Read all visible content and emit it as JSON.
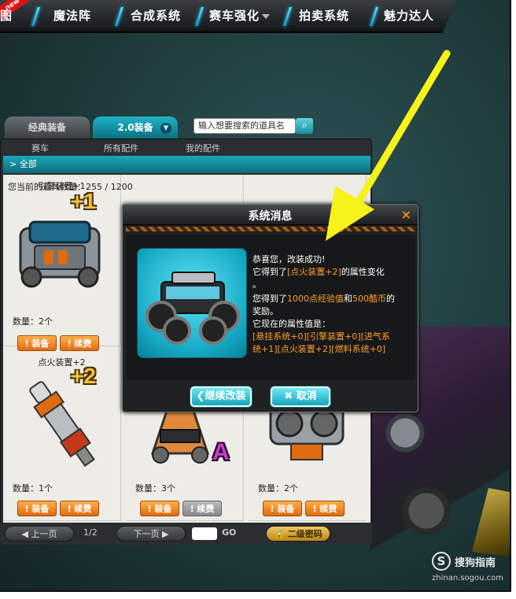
{
  "topnav": {
    "items": [
      {
        "label": "图"
      },
      {
        "label": "魔法阵"
      },
      {
        "label": "合成系统"
      },
      {
        "label": "赛车强化"
      },
      {
        "label": "拍卖系统"
      },
      {
        "label": "魅力达人"
      }
    ],
    "new_badge": "new"
  },
  "inventory": {
    "tabs": {
      "classic": "经典装备",
      "v20": "2.0装备"
    },
    "search_placeholder": "输入想要搜索的道具名",
    "subtabs": [
      "赛车",
      "所有配件",
      "我的配件"
    ],
    "category": "全部",
    "count_text": "您当前的道具数量：255 / 1200",
    "items": [
      {
        "name": "引擎装置+1",
        "badge": "+1",
        "qty": "数量：2个",
        "equip": "装备",
        "renew": "续费",
        "renew_disabled": false
      },
      {
        "name": "",
        "badge": "",
        "qty": "",
        "equip": "",
        "renew": "",
        "renew_disabled": false
      },
      {
        "name": "",
        "badge": "",
        "qty": "",
        "equip": "",
        "renew": "",
        "renew_disabled": false
      },
      {
        "name": "点火装置+2",
        "badge": "+2",
        "qty": "数量：1个",
        "equip": "装备",
        "renew": "续费",
        "renew_disabled": false
      },
      {
        "name": "",
        "badge": "A",
        "qty": "数量：3个",
        "equip": "装备",
        "renew": "续费",
        "renew_disabled": true
      },
      {
        "name": "",
        "badge": "",
        "qty": "数量：2个",
        "equip": "装备",
        "renew": "续费",
        "renew_disabled": false
      }
    ],
    "pager": {
      "prev": "上一页",
      "page": "1/2",
      "next": "下一页",
      "go": "GO",
      "second_pwd": "二级密码"
    }
  },
  "dialog": {
    "title": "系统消息",
    "close": "×",
    "line1": "恭喜您，改装成功!",
    "line2_pre": "它得到了",
    "line2_hl": "[点火装置+2]",
    "line2_post": "的属性变化",
    "line3": "。",
    "line4_pre": "您得到了",
    "line4_exp": "1000点经验值",
    "line4_mid": "和",
    "line4_coin": "500酷币",
    "line4_post": "的",
    "line5": "奖励。",
    "line6": "它现在的属性值是：",
    "attr1": "[悬挂系统+0][引擎装置+0][进气系",
    "attr2": "统+1][点火装置+2][燃料系统+0]",
    "btn_continue": "继续改装",
    "btn_cancel": "取消"
  },
  "watermark": {
    "name": "搜狗指南",
    "url": "zhinan.sogou.com",
    "logo": "S"
  },
  "colors": {
    "accent_cyan": "#1ba8bb",
    "orange": "#ff9d2a",
    "arrow_yellow": "#f7f21a"
  }
}
